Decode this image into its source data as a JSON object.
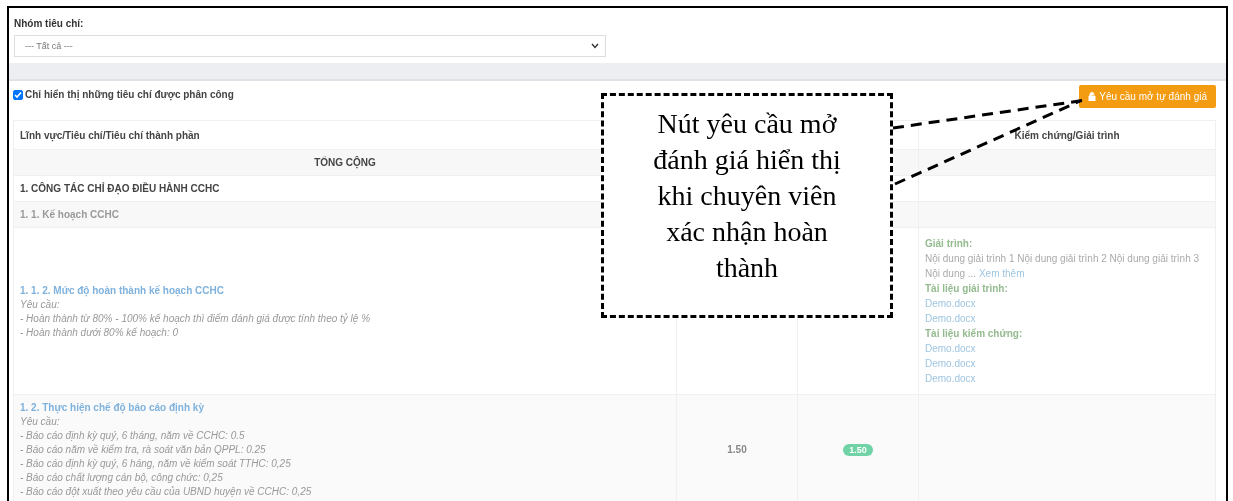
{
  "filter": {
    "label": "Nhóm tiêu chí:",
    "value": "--- Tất cả ---"
  },
  "assigned_only": {
    "label": "Chỉ hiển thị những tiêu chí được phân công",
    "checked": true
  },
  "request_button": {
    "label": "Yêu cầu mở tự đánh giá"
  },
  "table": {
    "header": {
      "column_1": "Lĩnh vực/Tiêu chí/Tiêu chí thành phần",
      "column_4": "Kiểm chứng/Giải trình"
    },
    "rows": [
      {
        "kind": "total",
        "label": "TỔNG CỘNG"
      },
      {
        "kind": "group",
        "label": "1. CÔNG TÁC CHỈ ĐẠO ĐIỀU HÀNH CCHC"
      },
      {
        "kind": "subgroup",
        "label": "1. 1. Kế hoạch CCHC"
      },
      {
        "kind": "criterion",
        "title": "1. 1. 2. Mức độ hoàn thành kế hoạch CCHC",
        "requirement_label": "Yêu cầu:",
        "requirements": [
          "- Hoàn thành từ 80% - 100% kế hoạch thì điểm đánh giá được tính theo tỷ lệ %",
          "- Hoàn thành dưới 80% kế hoạch: 0"
        ],
        "evidence": {
          "explanation_label": "Giải trình:",
          "explanation": "Nội dung giải trình 1 Nội dung giải trình 2 Nội dung giải trình 3 Nội dung ...",
          "more_link": "Xem thêm",
          "docs_label": "Tài liệu giải trình:",
          "docs": [
            "Demo.docx",
            "Demo.docx"
          ],
          "proofs_label": "Tài liệu kiểm chứng:",
          "proofs": [
            "Demo.docx",
            "Demo.docx",
            "Demo.docx"
          ]
        }
      },
      {
        "kind": "criterion",
        "title": "1. 2. Thực hiện chế độ báo cáo định kỳ",
        "requirement_label": "Yêu cầu:",
        "requirements": [
          "- Báo cáo định kỳ quý, 6 tháng, năm về CCHC: 0.5",
          "- Báo cáo năm về kiểm tra, rà soát văn bản QPPL: 0.25",
          "- Báo cáo định kỳ quý, 6 háng, năm về kiểm soát TTHC: 0,25",
          "- Báo cáo chất lượng cán bộ, công chức: 0,25",
          "- Báo cáo đột xuất theo yêu cầu của UBND huyện về CCHC: 0,25"
        ],
        "score": "1.50",
        "score_badge": "1.50"
      }
    ]
  },
  "annotation": {
    "text": "Nút yêu cầu mở đánh giá hiển thị khi chuyên viên xác nhận hoàn thành"
  }
}
